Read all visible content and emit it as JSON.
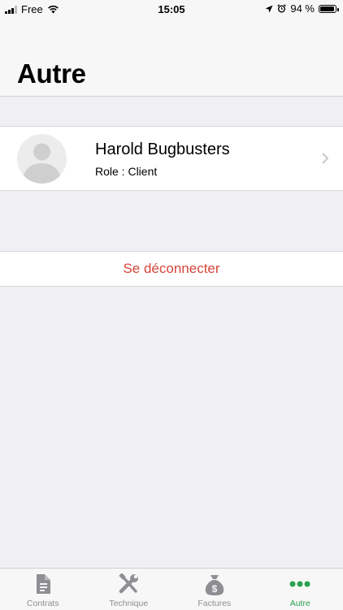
{
  "status_bar": {
    "carrier": "Free",
    "time": "15:05",
    "battery": "94 %",
    "battery_level": 0.94
  },
  "header": {
    "title": "Autre"
  },
  "profile": {
    "name": "Harold Bugbusters",
    "role": "Role : Client"
  },
  "logout": {
    "label": "Se déconnecter",
    "color": "#d6453a"
  },
  "tabs": [
    {
      "label": "Contrats",
      "icon": "document-icon",
      "active": false
    },
    {
      "label": "Technique",
      "icon": "tools-icon",
      "active": false
    },
    {
      "label": "Factures",
      "icon": "money-bag-icon",
      "active": false
    },
    {
      "label": "Autre",
      "icon": "more-dots-icon",
      "active": true
    }
  ],
  "colors": {
    "accent": "#2aa14e",
    "inactive": "#8e8e93",
    "destructive": "#d6453a"
  }
}
